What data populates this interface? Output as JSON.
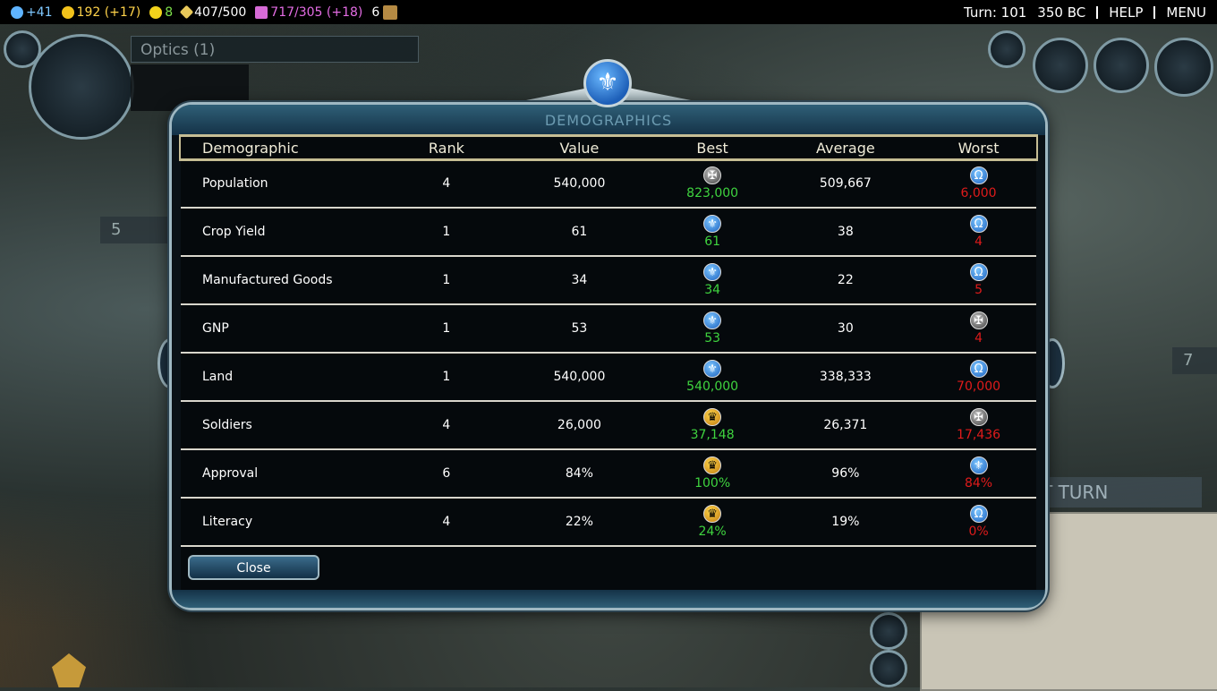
{
  "topbar": {
    "science": "+41",
    "gold": "192 (+17)",
    "happiness": "8",
    "golden_age": "407/500",
    "culture": "717/305 (+18)",
    "policies": "6",
    "turn": "Turn: 101",
    "year": "350 BC",
    "help": "HELP",
    "menu": "MENU"
  },
  "background": {
    "optics_label": "Optics (1)",
    "next_turn_label": "T TURN",
    "unit_count": "5",
    "city_count": "7"
  },
  "dialog": {
    "title": "DEMOGRAPHICS",
    "close_label": "Close",
    "headers": {
      "demographic": "Demographic",
      "rank": "Rank",
      "value": "Value",
      "best": "Best",
      "average": "Average",
      "worst": "Worst"
    },
    "rows": [
      {
        "name": "Population",
        "rank": "4",
        "value": "540,000",
        "best_civ": "gray",
        "best": "823,000",
        "average": "509,667",
        "worst_civ": "blue-omega",
        "worst": "6,000"
      },
      {
        "name": "Crop Yield",
        "rank": "1",
        "value": "61",
        "best_civ": "blue-fleur",
        "best": "61",
        "average": "38",
        "worst_civ": "blue-omega",
        "worst": "4"
      },
      {
        "name": "Manufactured Goods",
        "rank": "1",
        "value": "34",
        "best_civ": "blue-fleur",
        "best": "34",
        "average": "22",
        "worst_civ": "blue-omega",
        "worst": "5"
      },
      {
        "name": "GNP",
        "rank": "1",
        "value": "53",
        "best_civ": "blue-fleur",
        "best": "53",
        "average": "30",
        "worst_civ": "gray",
        "worst": "4"
      },
      {
        "name": "Land",
        "rank": "1",
        "value": "540,000",
        "best_civ": "blue-fleur",
        "best": "540,000",
        "average": "338,333",
        "worst_civ": "blue-omega",
        "worst": "70,000"
      },
      {
        "name": "Soldiers",
        "rank": "4",
        "value": "26,000",
        "best_civ": "gold-eagle",
        "best": "37,148",
        "average": "26,371",
        "worst_civ": "gray",
        "worst": "17,436"
      },
      {
        "name": "Approval",
        "rank": "6",
        "value": "84%",
        "best_civ": "gold-eagle",
        "best": "100%",
        "average": "96%",
        "worst_civ": "blue-fleur",
        "worst": "84%"
      },
      {
        "name": "Literacy",
        "rank": "4",
        "value": "22%",
        "best_civ": "gold-eagle",
        "best": "24%",
        "average": "19%",
        "worst_civ": "blue-omega",
        "worst": "0%"
      }
    ]
  },
  "colors": {
    "best": "#3fd43f",
    "average": "#e8dc4a",
    "worst": "#e01b1b",
    "header_border": "#c6bd94"
  }
}
